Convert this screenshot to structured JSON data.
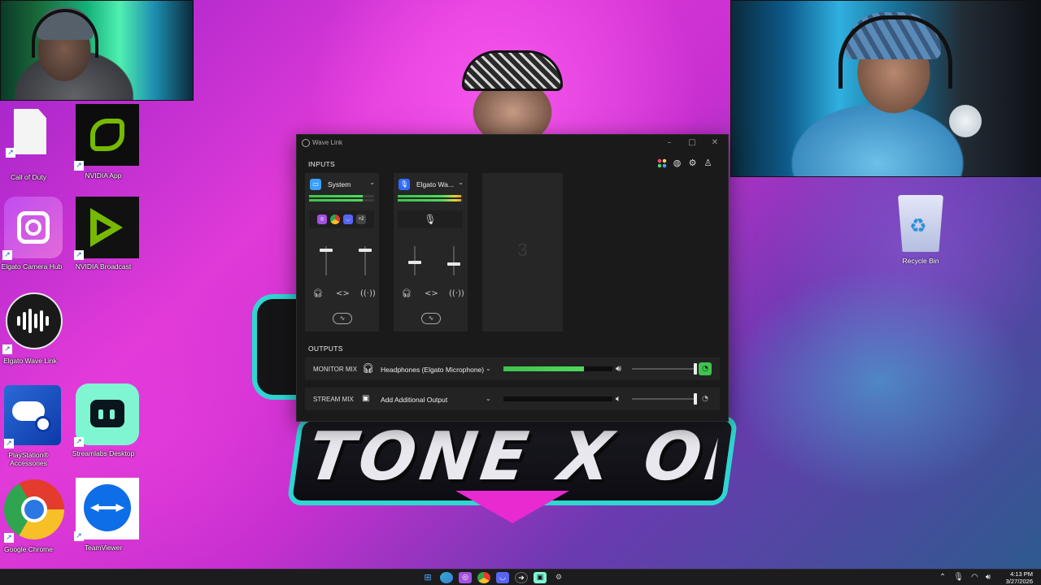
{
  "desktop": {
    "icons": [
      {
        "label": "Call of Duty",
        "icon": "blank-file-icon"
      },
      {
        "label": "NVIDIA App",
        "icon": "nvidia-icon"
      },
      {
        "label": "Elgato Camera Hub",
        "icon": "camera-hub-icon"
      },
      {
        "label": "NVIDIA Broadcast",
        "icon": "nvidia-broadcast-icon"
      },
      {
        "label": "Elgato Wave Link",
        "icon": "wave-link-icon"
      },
      {
        "label": "PlayStation® Accessories",
        "icon": "playstation-accessories-icon"
      },
      {
        "label": "Streamlabs Desktop",
        "icon": "streamlabs-icon"
      },
      {
        "label": "Google Chrome",
        "icon": "chrome-icon"
      },
      {
        "label": "TeamViewer",
        "icon": "teamviewer-icon"
      }
    ],
    "recycle_bin": {
      "label": "Recycle Bin"
    },
    "wallpaper_text": "TONE X OFIVE"
  },
  "wave_link": {
    "title": "Wave Link",
    "inputs_label": "INPUTS",
    "outputs_label": "OUTPUTS",
    "channels": [
      {
        "name": "System",
        "meter_level": 0.82,
        "apps_more": "+2",
        "faders": [
          0.85,
          0.85
        ]
      },
      {
        "name": "Elgato Wa...",
        "meter_level": 0.98,
        "faders": [
          0.45,
          0.4
        ]
      }
    ],
    "empty_slot_number": "3",
    "outputs": [
      {
        "label": "MONITOR MIX",
        "device": "Headphones (Elgato Microphone)",
        "meter_level": 0.74,
        "volume": 1.0,
        "monitor_active": true
      },
      {
        "label": "STREAM MIX",
        "device": "Add Additional Output",
        "meter_level": 0.0,
        "volume": 1.0,
        "monitor_active": false
      }
    ],
    "colors": {
      "accent": "#3ec34e",
      "system_icon": "#3aa0ff",
      "mic_icon": "#2f6bff"
    }
  },
  "taskbar": {
    "time": "4:13 PM",
    "date": "3/27/2026"
  }
}
